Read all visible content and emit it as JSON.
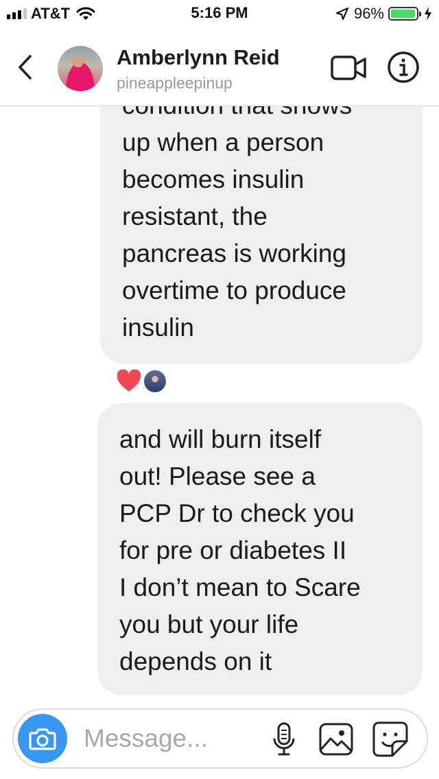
{
  "status_bar": {
    "carrier": "AT&T",
    "time": "5:16 PM",
    "battery_percent": "96%",
    "signal_bars_filled": 3,
    "signal_bars_total": 4,
    "battery_level": 0.96,
    "battery_color": "#4cd964"
  },
  "header": {
    "name": "Amberlynn Reid",
    "username": "pineappleepinup",
    "back_icon": "chevron-left-icon",
    "video_icon": "video-camera-icon",
    "info_icon": "info-icon"
  },
  "messages": [
    {
      "lines": [
        "condition that shows",
        "up when a person",
        "becomes insulin",
        "resistant, the",
        "pancreas is working",
        "overtime to produce",
        "insulin"
      ],
      "reactions": [
        "heart-icon",
        "reactor-avatar"
      ]
    },
    {
      "lines": [
        "and will burn itself",
        "out! Please see a",
        "PCP Dr to check you",
        "for pre or diabetes II",
        "I don’t mean to Scare",
        "you but your life",
        "depends on it"
      ]
    }
  ],
  "composer": {
    "placeholder": "Message...",
    "camera_icon": "camera-icon",
    "mic_icon": "microphone-icon",
    "gallery_icon": "image-gallery-icon",
    "sticker_icon": "sticker-icon"
  },
  "colors": {
    "accent": "#3897f0",
    "bubble": "#efefef",
    "reaction_heart": "#ed4956"
  }
}
